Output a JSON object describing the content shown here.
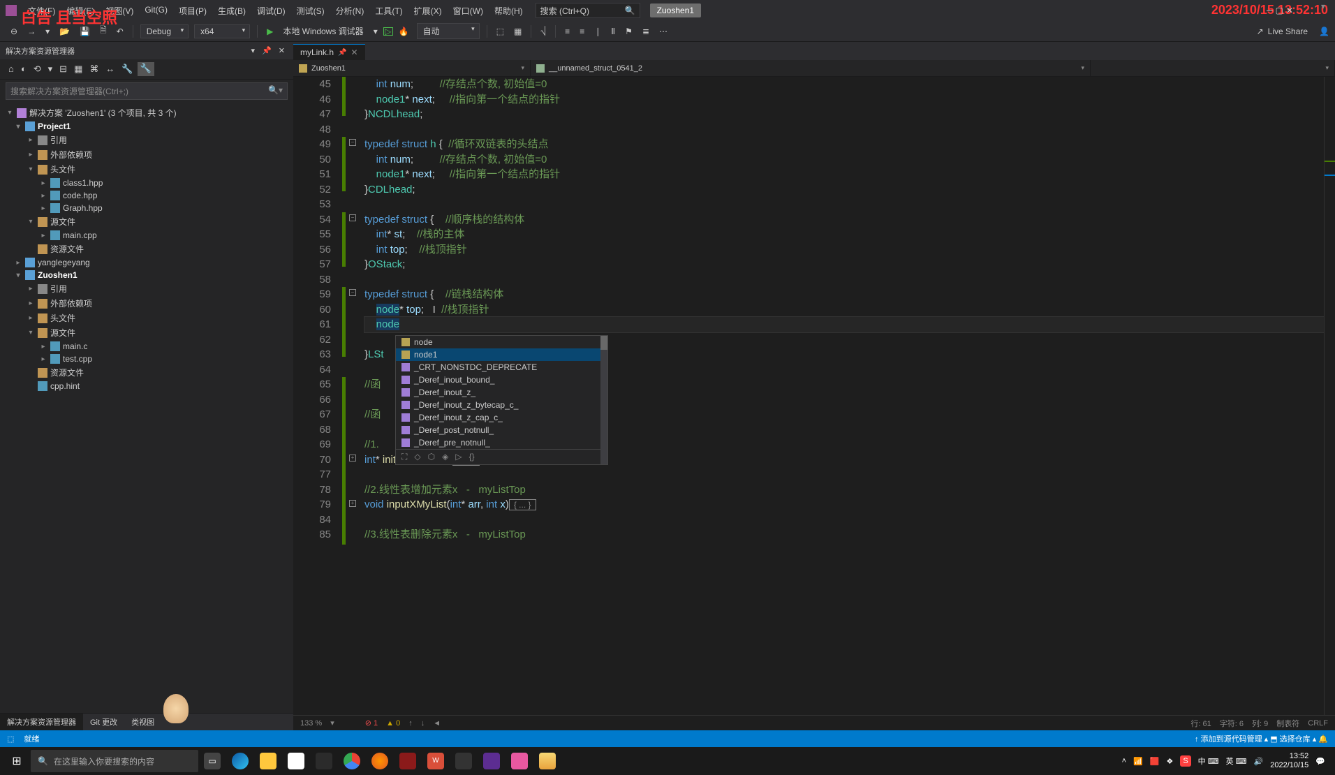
{
  "overlay": {
    "red_text": "白告 且当空照",
    "timestamp": "2023/10/15 13:52:10"
  },
  "menu": [
    "文件(F)",
    "编辑(E)",
    "视图(V)",
    "Git(G)",
    "项目(P)",
    "生成(B)",
    "调试(D)",
    "测试(S)",
    "分析(N)",
    "工具(T)",
    "扩展(X)",
    "窗口(W)",
    "帮助(H)"
  ],
  "search_placeholder": "搜索 (Ctrl+Q)",
  "solution_badge": "Zuoshen1",
  "toolbar": {
    "config": "Debug",
    "platform": "x64",
    "run": "本地 Windows 调试器",
    "auto": "自动"
  },
  "live_share": "Live Share",
  "sidebar": {
    "title": "解决方案资源管理器",
    "search_placeholder": "搜索解决方案资源管理器(Ctrl+;)",
    "sln_label": "解决方案 'Zuoshen1' (3 个项目, 共 3 个)",
    "tree": [
      {
        "d": 1,
        "exp": "▾",
        "ico": "proj",
        "t": "Project1",
        "bold": true
      },
      {
        "d": 2,
        "exp": "▸",
        "ico": "ref",
        "t": "引用"
      },
      {
        "d": 2,
        "exp": "▸",
        "ico": "folder",
        "t": "外部依赖项"
      },
      {
        "d": 2,
        "exp": "▾",
        "ico": "folder",
        "t": "头文件"
      },
      {
        "d": 3,
        "exp": "▸",
        "ico": "h",
        "t": "class1.hpp"
      },
      {
        "d": 3,
        "exp": "▸",
        "ico": "h",
        "t": "code.hpp"
      },
      {
        "d": 3,
        "exp": "▸",
        "ico": "h",
        "t": "Graph.hpp"
      },
      {
        "d": 2,
        "exp": "▾",
        "ico": "folder",
        "t": "源文件"
      },
      {
        "d": 3,
        "exp": "▸",
        "ico": "cpp",
        "t": "main.cpp"
      },
      {
        "d": 2,
        "exp": "",
        "ico": "folder",
        "t": "资源文件"
      },
      {
        "d": 1,
        "exp": "▸",
        "ico": "proj",
        "t": "yanglegeyang"
      },
      {
        "d": 1,
        "exp": "▾",
        "ico": "proj",
        "t": "Zuoshen1",
        "bold": true
      },
      {
        "d": 2,
        "exp": "▸",
        "ico": "ref",
        "t": "引用"
      },
      {
        "d": 2,
        "exp": "▸",
        "ico": "folder",
        "t": "外部依赖项"
      },
      {
        "d": 2,
        "exp": "▸",
        "ico": "folder",
        "t": "头文件"
      },
      {
        "d": 2,
        "exp": "▾",
        "ico": "folder",
        "t": "源文件"
      },
      {
        "d": 3,
        "exp": "▸",
        "ico": "cpp",
        "t": "main.c"
      },
      {
        "d": 3,
        "exp": "▸",
        "ico": "cpp",
        "t": "test.cpp"
      },
      {
        "d": 2,
        "exp": "",
        "ico": "folder",
        "t": "资源文件"
      },
      {
        "d": 2,
        "exp": "",
        "ico": "h",
        "t": "cpp.hint"
      }
    ],
    "bottom_tabs": [
      "解决方案资源管理器",
      "Git 更改",
      "类视图"
    ]
  },
  "editor": {
    "tab_name": "myLink.h",
    "nav_left": "Zuoshen1",
    "nav_right": "__unnamed_struct_0541_2",
    "zoom": "133 %",
    "err_count": "1",
    "warn_count": "0",
    "lines": [
      {
        "n": 45,
        "html": "    <span class='kw'>int</span> <span class='var'>num</span>;         <span class='cmt'>//存结点个数, 初始值=0</span>"
      },
      {
        "n": 46,
        "html": "    <span class='type'>node1</span>* <span class='var'>next</span>;     <span class='cmt'>//指向第一个结点的指针</span>"
      },
      {
        "n": 47,
        "html": "}<span class='type'>NCDLhead</span>;"
      },
      {
        "n": 48,
        "html": ""
      },
      {
        "n": 49,
        "html": "<span class='kw'>typedef</span> <span class='kw'>struct</span> <span class='type'>h</span> {  <span class='cmt'>//循环双链表的头结点</span>"
      },
      {
        "n": 50,
        "html": "    <span class='kw'>int</span> <span class='var'>num</span>;         <span class='cmt'>//存结点个数, 初始值=0</span>"
      },
      {
        "n": 51,
        "html": "    <span class='type'>node1</span>* <span class='var'>next</span>;     <span class='cmt'>//指向第一个结点的指针</span>"
      },
      {
        "n": 52,
        "html": "}<span class='type'>CDLhead</span>;"
      },
      {
        "n": 53,
        "html": ""
      },
      {
        "n": 54,
        "html": "<span class='kw'>typedef</span> <span class='kw'>struct</span> {    <span class='cmt'>//顺序栈的结构体</span>"
      },
      {
        "n": 55,
        "html": "    <span class='kw'>int</span>* <span class='var'>st</span>;    <span class='cmt'>//栈的主体</span>"
      },
      {
        "n": 56,
        "html": "    <span class='kw'>int</span> <span class='var'>top</span>;    <span class='cmt'>//栈顶指针</span>"
      },
      {
        "n": 57,
        "html": "}<span class='type'>OStack</span>;"
      },
      {
        "n": 58,
        "html": ""
      },
      {
        "n": 59,
        "html": "<span class='kw'>typedef</span> <span class='kw'>struct</span> {    <span class='cmt'>//链栈结构体</span>"
      },
      {
        "n": 60,
        "html": "    <span class='type sel'>node</span>* <span class='var'>top</span>;   <span style='color:#ccc'>I</span>  <span class='cmt'>//栈顶指针</span>"
      },
      {
        "n": 61,
        "html": "    <span class='type sel'>node</span>",
        "current": true
      },
      {
        "n": 62,
        "html": ""
      },
      {
        "n": 63,
        "html": "}<span class='type'>LSt</span>"
      },
      {
        "n": 64,
        "html": ""
      },
      {
        "n": 65,
        "html": "<span class='cmt'>//函</span>"
      },
      {
        "n": 66,
        "html": ""
      },
      {
        "n": 67,
        "html": "<span class='cmt'>//函</span>"
      },
      {
        "n": 68,
        "html": ""
      },
      {
        "n": 69,
        "html": "<span class='cmt'>//1.</span>"
      },
      {
        "n": 70,
        "html": "<span class='kw'>int</span>* <span class='fn'>initMyList</span>(<span class='kw'>void</span>)<span class='fold-box'>{ ... }</span>"
      },
      {
        "n": 77,
        "html": ""
      },
      {
        "n": 78,
        "html": "<span class='cmt'>//2.线性表增加元素x   -   myListTop</span>"
      },
      {
        "n": 79,
        "html": "<span class='kw'>void</span> <span class='fn'>inputXMyList</span>(<span class='kw'>int</span>* <span class='var'>arr</span>, <span class='kw'>int</span> <span class='var'>x</span>)<span class='fold-box'>{ ... }</span>"
      },
      {
        "n": 84,
        "html": ""
      },
      {
        "n": 85,
        "html": "<span class='cmt'>//3.线性表删除元素x   -   myListTop</span>"
      }
    ],
    "intellisense": [
      {
        "ico": "struct",
        "t": "node"
      },
      {
        "ico": "struct",
        "t": "node1",
        "sel": true
      },
      {
        "ico": "def",
        "t": "_CRT_NONSTDC_DEPRECATE"
      },
      {
        "ico": "def",
        "t": "_Deref_inout_bound_"
      },
      {
        "ico": "def",
        "t": "_Deref_inout_z_"
      },
      {
        "ico": "def",
        "t": "_Deref_inout_z_bytecap_c_"
      },
      {
        "ico": "def",
        "t": "_Deref_inout_z_cap_c_"
      },
      {
        "ico": "def",
        "t": "_Deref_post_notnull_"
      },
      {
        "ico": "def",
        "t": "_Deref_pre_notnull_"
      }
    ]
  },
  "status_right": {
    "line": "行: 61",
    "char": "字符: 6",
    "col": "列: 9",
    "tab": "制表符",
    "crlf": "CRLF"
  },
  "main_status": {
    "left": [
      "",
      "就绪"
    ],
    "right": "↑ 添加到源代码管理 ▴   ⬒ 选择仓库 ▴   🔔"
  },
  "taskbar": {
    "search": "在这里输入你要搜索的内容",
    "time": "13:52",
    "date": "2022/10/15",
    "ime1": "中 ⌨",
    "ime2": "英 ⌨"
  }
}
